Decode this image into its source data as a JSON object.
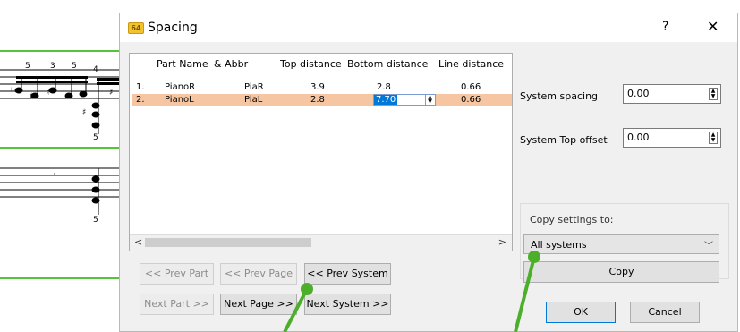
{
  "window": {
    "title": "Spacing",
    "app_icon_text": "64",
    "help_label": "?",
    "close_label": "✕"
  },
  "table": {
    "headers": {
      "part_name": "Part Name",
      "abbr": "& Abbr",
      "top": "Top distance",
      "bottom": "Bottom distance",
      "line": "Line distance"
    },
    "rows": [
      {
        "index": "1.",
        "name": "PianoR",
        "abbr": "PiaR",
        "top": "3.9",
        "bottom": "2.8",
        "line": "0.66"
      },
      {
        "index": "2.",
        "name": "PianoL",
        "abbr": "PiaL",
        "top": "2.8",
        "bottom": "7.70",
        "line": "0.66"
      }
    ],
    "selected_row": 1,
    "scroll_left": "<",
    "scroll_right": ">"
  },
  "nav": {
    "prev_part": "<< Prev Part",
    "prev_page": "<< Prev Page",
    "prev_system": "<< Prev System",
    "next_part": "Next Part >>",
    "next_page": "Next Page >>",
    "next_system": "Next System >>"
  },
  "system_spacing": {
    "label": "System spacing",
    "value": "0.00"
  },
  "system_top_offset": {
    "label": "System Top offset",
    "value": "0.00"
  },
  "copy_settings": {
    "title": "Copy settings to:",
    "selected": "All systems",
    "button": "Copy"
  },
  "footer": {
    "ok": "OK",
    "cancel": "Cancel"
  },
  "colors": {
    "selection": "#f5c6a1",
    "edit_highlight": "#0078d7",
    "annotation_green": "#4caf2a",
    "score_green": "#56c43a"
  }
}
